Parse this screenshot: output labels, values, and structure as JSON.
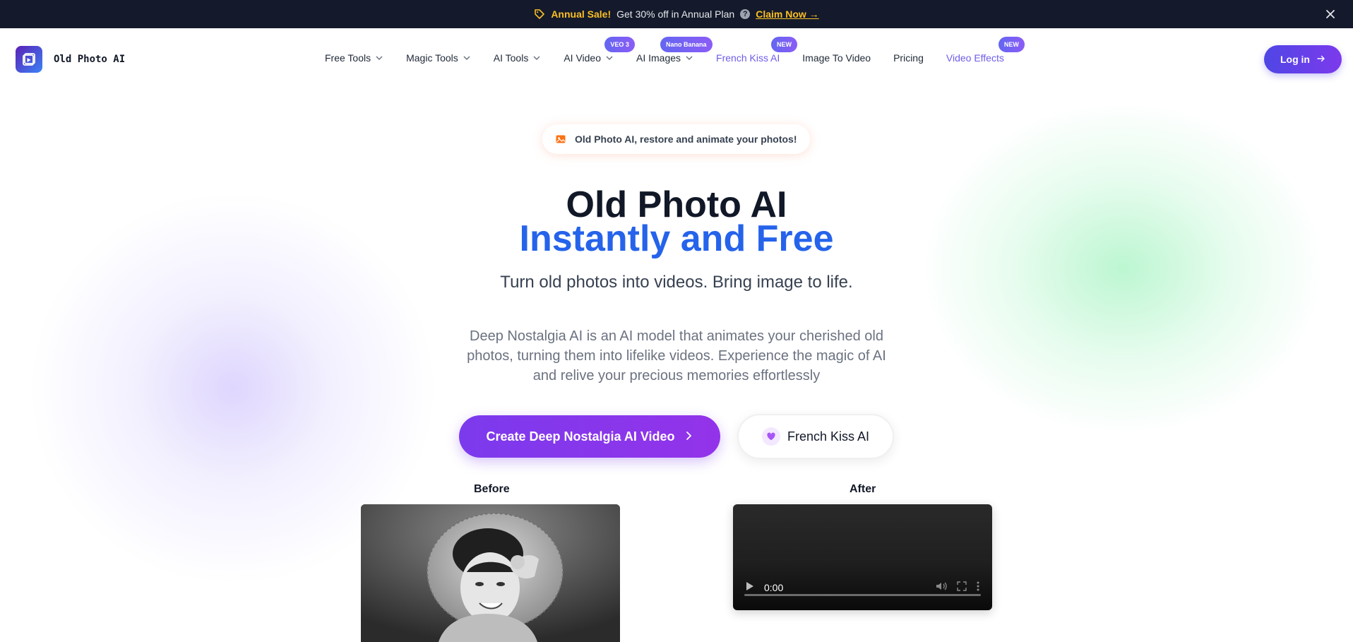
{
  "banner": {
    "sale_label": "Annual Sale!",
    "offer_text": "Get 30% off in Annual Plan",
    "help_glyph": "?",
    "claim_label": "Claim Now →"
  },
  "logo": {
    "text": "Old Photo AI"
  },
  "nav": {
    "items": [
      {
        "label": "Free Tools"
      },
      {
        "label": "Magic Tools"
      },
      {
        "label": "AI Tools"
      },
      {
        "label": "AI Video",
        "badge": "VEO 3"
      },
      {
        "label": "AI Images",
        "badge": "Nano Banana"
      },
      {
        "label": "French Kiss AI",
        "badge": "NEW"
      },
      {
        "label": "Image To Video"
      },
      {
        "label": "Pricing"
      },
      {
        "label": "Video Effects",
        "badge": "NEW"
      }
    ],
    "login_label": "Log in"
  },
  "hero": {
    "pill_text": "Old Photo AI, restore and animate your photos!",
    "title_line1": "Old Photo AI",
    "title_line2": "Instantly and Free",
    "subhead": "Turn old photos into videos. Bring image to life.",
    "description": "Deep Nostalgia AI is an AI model that animates your cherished old photos, turning them into lifelike videos. Experience the magic of AI and relive your precious memories effortlessly",
    "primary_button": "Create Deep Nostalgia AI Video",
    "secondary_button": "French Kiss AI"
  },
  "compare": {
    "before_label": "Before",
    "after_label": "After",
    "video_time": "0:00"
  },
  "colors": {
    "banner_bg": "#141a2b",
    "accent_yellow": "#fbbf24",
    "primary_purple": "#7c3aed",
    "title_blue": "#2563eb",
    "nav_accent": "#6d5ce8"
  },
  "icons": {
    "banner": "tag-icon",
    "close": "close-icon",
    "logo": "play-square-icon",
    "pill": "image-icon",
    "secondary": "heart-icon"
  }
}
